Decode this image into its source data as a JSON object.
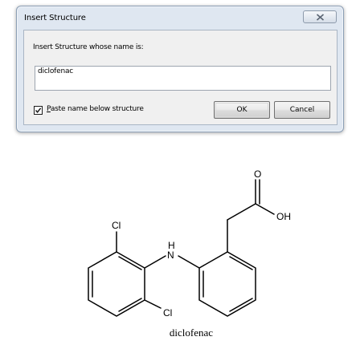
{
  "dialog": {
    "title": "Insert Structure",
    "close_icon": "close-icon",
    "prompt": "Insert Structure whose name is:",
    "name_value": "diclofenac",
    "checkbox": {
      "checked": true,
      "label_mnemonic": "P",
      "label_rest": "aste name below structure"
    },
    "ok_label": "OK",
    "cancel_label": "Cancel"
  },
  "structure": {
    "atoms": {
      "cl_top": "Cl",
      "cl_bottom": "Cl",
      "nitrogen": "N",
      "hydrogen": "H",
      "oxygen_carbonyl": "O",
      "hydroxyl": "OH"
    },
    "caption": "diclofenac"
  }
}
